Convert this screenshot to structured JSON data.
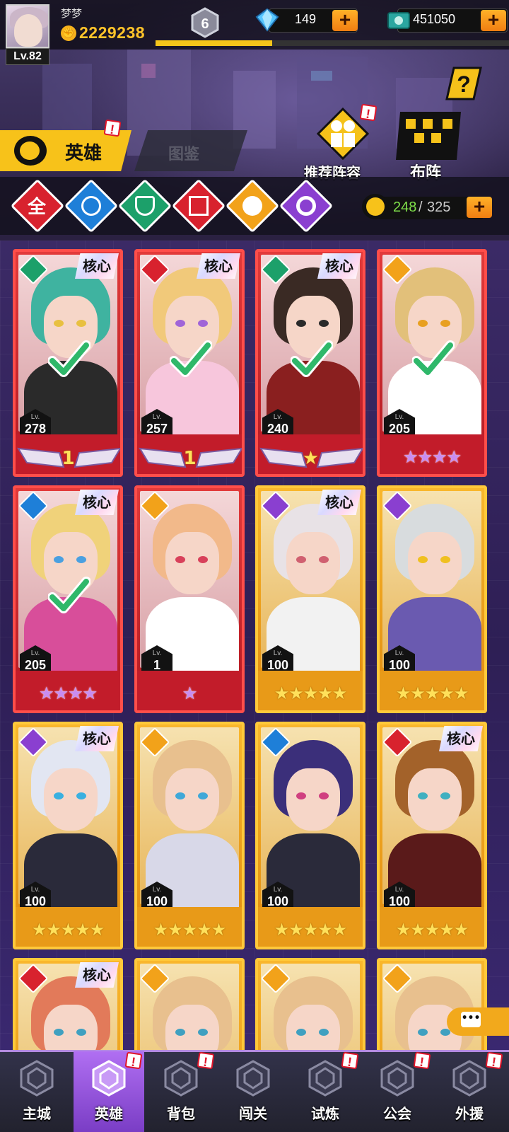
{
  "player": {
    "name": "梦梦",
    "level_label": "Lv.82",
    "power": "2229238",
    "vip_level": "6",
    "exp_progress_percent": 33
  },
  "resources": {
    "gems": "149",
    "coins": "451050",
    "plus_label": "+"
  },
  "header": {
    "tab_hero": "英雄",
    "tab_codex": "图鉴",
    "recommend_label": "推荐阵容",
    "formation_label": "布阵",
    "help_label": "?",
    "alert_mark": "!"
  },
  "filters": {
    "all_label": "全",
    "items": [
      "all",
      "water",
      "wind",
      "fire",
      "light",
      "dark"
    ]
  },
  "hero_count": {
    "current": "248",
    "separator": "/",
    "max": "325"
  },
  "heroes": [
    {
      "lv_label": "Lv.",
      "level": "278",
      "core": "核心",
      "element": "wind",
      "selected": true,
      "frame": "red",
      "rank_text": "1",
      "stars": ""
    },
    {
      "lv_label": "Lv.",
      "level": "257",
      "core": "核心",
      "element": "fire",
      "selected": true,
      "frame": "red",
      "rank_text": "1",
      "stars": ""
    },
    {
      "lv_label": "Lv.",
      "level": "240",
      "core": "核心",
      "element": "wind",
      "selected": true,
      "frame": "red",
      "rank_text": "★",
      "stars": ""
    },
    {
      "lv_label": "Lv.",
      "level": "205",
      "core": "",
      "element": "light",
      "selected": true,
      "frame": "red",
      "rank_text": "",
      "stars": "★★★★"
    },
    {
      "lv_label": "Lv.",
      "level": "205",
      "core": "核心",
      "element": "water",
      "selected": true,
      "frame": "red",
      "rank_text": "",
      "stars": "★★★★"
    },
    {
      "lv_label": "Lv.",
      "level": "1",
      "core": "",
      "element": "light",
      "selected": false,
      "frame": "red",
      "rank_text": "",
      "stars": "★"
    },
    {
      "lv_label": "Lv.",
      "level": "100",
      "core": "核心",
      "element": "dark",
      "selected": false,
      "frame": "gold",
      "rank_text": "",
      "stars": "★★★★★"
    },
    {
      "lv_label": "Lv.",
      "level": "100",
      "core": "",
      "element": "dark",
      "selected": false,
      "frame": "gold",
      "rank_text": "",
      "stars": "★★★★★"
    },
    {
      "lv_label": "Lv.",
      "level": "100",
      "core": "核心",
      "element": "dark",
      "selected": false,
      "frame": "gold",
      "rank_text": "",
      "stars": "★★★★★"
    },
    {
      "lv_label": "Lv.",
      "level": "100",
      "core": "",
      "element": "light",
      "selected": false,
      "frame": "gold",
      "rank_text": "",
      "stars": "★★★★★"
    },
    {
      "lv_label": "Lv.",
      "level": "100",
      "core": "",
      "element": "water",
      "selected": false,
      "frame": "gold",
      "rank_text": "",
      "stars": "★★★★★"
    },
    {
      "lv_label": "Lv.",
      "level": "100",
      "core": "核心",
      "element": "fire",
      "selected": false,
      "frame": "gold",
      "rank_text": "",
      "stars": "★★★★★"
    },
    {
      "lv_label": "",
      "level": "",
      "core": "核心",
      "element": "fire",
      "selected": false,
      "frame": "gold",
      "rank_text": "",
      "stars": ""
    },
    {
      "lv_label": "",
      "level": "",
      "core": "",
      "element": "light",
      "selected": false,
      "frame": "gold",
      "rank_text": "",
      "stars": ""
    },
    {
      "lv_label": "",
      "level": "",
      "core": "",
      "element": "light",
      "selected": false,
      "frame": "gold",
      "rank_text": "",
      "stars": ""
    },
    {
      "lv_label": "",
      "level": "",
      "core": "",
      "element": "light",
      "selected": false,
      "frame": "gold",
      "rank_text": "",
      "stars": ""
    }
  ],
  "chat": {
    "label": "•••"
  },
  "nav": [
    {
      "label": "主城",
      "alert": false,
      "active": false
    },
    {
      "label": "英雄",
      "alert": true,
      "active": true
    },
    {
      "label": "背包",
      "alert": true,
      "active": false
    },
    {
      "label": "闯关",
      "alert": false,
      "active": false
    },
    {
      "label": "试炼",
      "alert": true,
      "active": false
    },
    {
      "label": "公会",
      "alert": true,
      "active": false
    },
    {
      "label": "外援",
      "alert": true,
      "active": false
    }
  ],
  "colors": {
    "accent_yellow": "#f7c21a",
    "frame_red": "#e23a3a",
    "frame_gold": "#f9b72c",
    "nav_active": "#b06ff2",
    "count_green": "#7fe04a",
    "elem_water": "#1e7fd8",
    "elem_wind": "#1ca06a",
    "elem_fire": "#d8222e",
    "elem_light": "#f2a21a",
    "elem_dark": "#8a3fd0"
  }
}
